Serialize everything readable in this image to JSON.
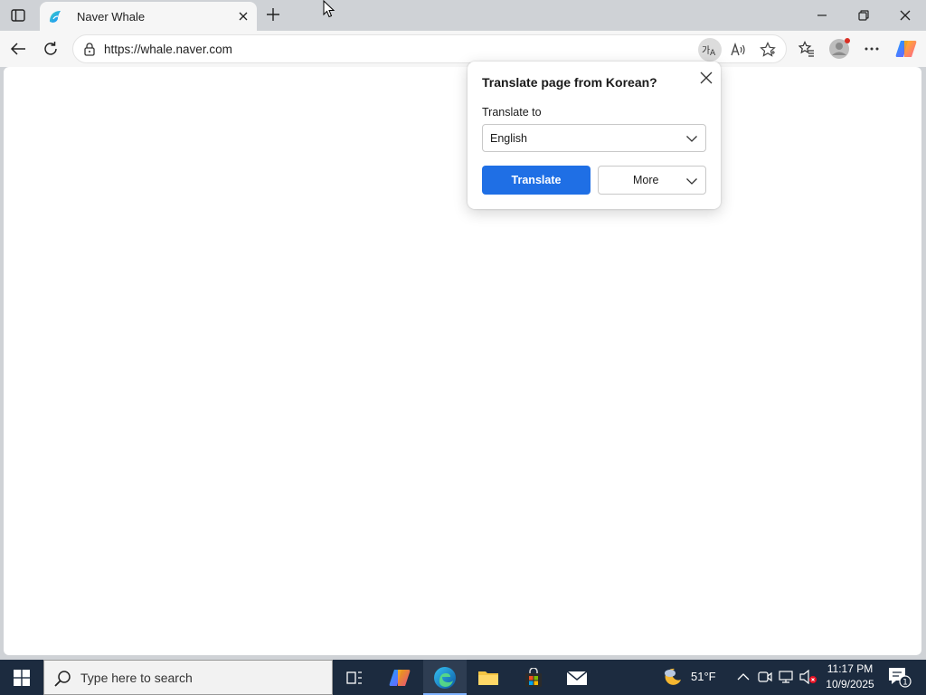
{
  "browser": {
    "tab": {
      "title": "Naver Whale"
    },
    "address_bar": {
      "url": "https://whale.naver.com"
    }
  },
  "translate_popup": {
    "title": "Translate page from Korean?",
    "translate_to_label": "Translate to",
    "selected_language": "English",
    "translate_button": "Translate",
    "more_button": "More"
  },
  "taskbar": {
    "search_placeholder": "Type here to search",
    "weather_temp": "51°F",
    "time": "11:17 PM",
    "date": "10/9/2025",
    "notification_count": "1"
  },
  "icons": {
    "tab_actions": "tab-actions-icon",
    "favicon": "whale-icon",
    "close": "close-icon",
    "new_tab": "plus-icon",
    "back": "back-arrow-icon",
    "refresh": "refresh-icon",
    "lock": "lock-icon",
    "translate": "translate-icon",
    "read_aloud": "read-aloud-icon",
    "favorite": "star-icon",
    "favorites": "favorites-icon",
    "profile": "profile-icon",
    "more": "more-dots-icon",
    "copilot": "copilot-icon"
  },
  "colors": {
    "accent": "#1f6fe5",
    "taskbar": "#1c2b3f",
    "tab_strip": "#cfd2d6"
  }
}
